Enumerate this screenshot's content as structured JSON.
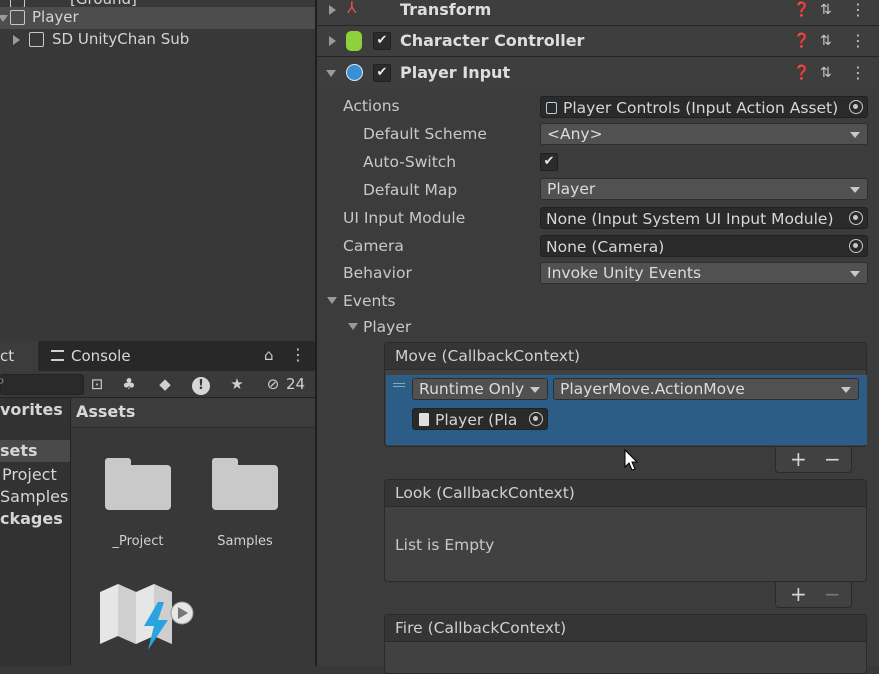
{
  "hierarchy": {
    "items": [
      {
        "label": "[Ground]"
      },
      {
        "label": "Player"
      },
      {
        "label": "SD UnityChan Sub"
      }
    ]
  },
  "project_panel": {
    "tabs": [
      "ct",
      "Console"
    ],
    "hidden_count": "24",
    "favorites": [
      "vorites",
      "sets",
      "Project",
      "Samples",
      "ckages"
    ],
    "assets_header": "Assets",
    "assets": [
      "_Project",
      "Samples"
    ]
  },
  "inspector": {
    "components": [
      {
        "title": "Transform"
      },
      {
        "title": "Character Controller"
      },
      {
        "title": "Player Input"
      }
    ],
    "properties": {
      "actions_label": "Actions",
      "actions_value": "Player Controls (Input Action Asset)",
      "default_scheme_label": "Default Scheme",
      "default_scheme_value": "<Any>",
      "auto_switch_label": "Auto-Switch",
      "auto_switch_checked": "✔",
      "default_map_label": "Default Map",
      "default_map_value": "Player",
      "ui_module_label": "UI Input Module",
      "ui_module_value": "None (Input System UI Input Module)",
      "camera_label": "Camera",
      "camera_value": "None (Camera)",
      "behavior_label": "Behavior",
      "behavior_value": "Invoke Unity Events",
      "events_label": "Events",
      "player_label": "Player"
    },
    "events": [
      {
        "title": "Move (CallbackContext)",
        "runtime": "Runtime Only",
        "function": "PlayerMove.ActionMove",
        "object": "Player (Pla"
      },
      {
        "title": "Look (CallbackContext)",
        "empty": "List is Empty"
      },
      {
        "title": "Fire (CallbackContext)"
      }
    ],
    "plus": "+",
    "minus": "−"
  }
}
